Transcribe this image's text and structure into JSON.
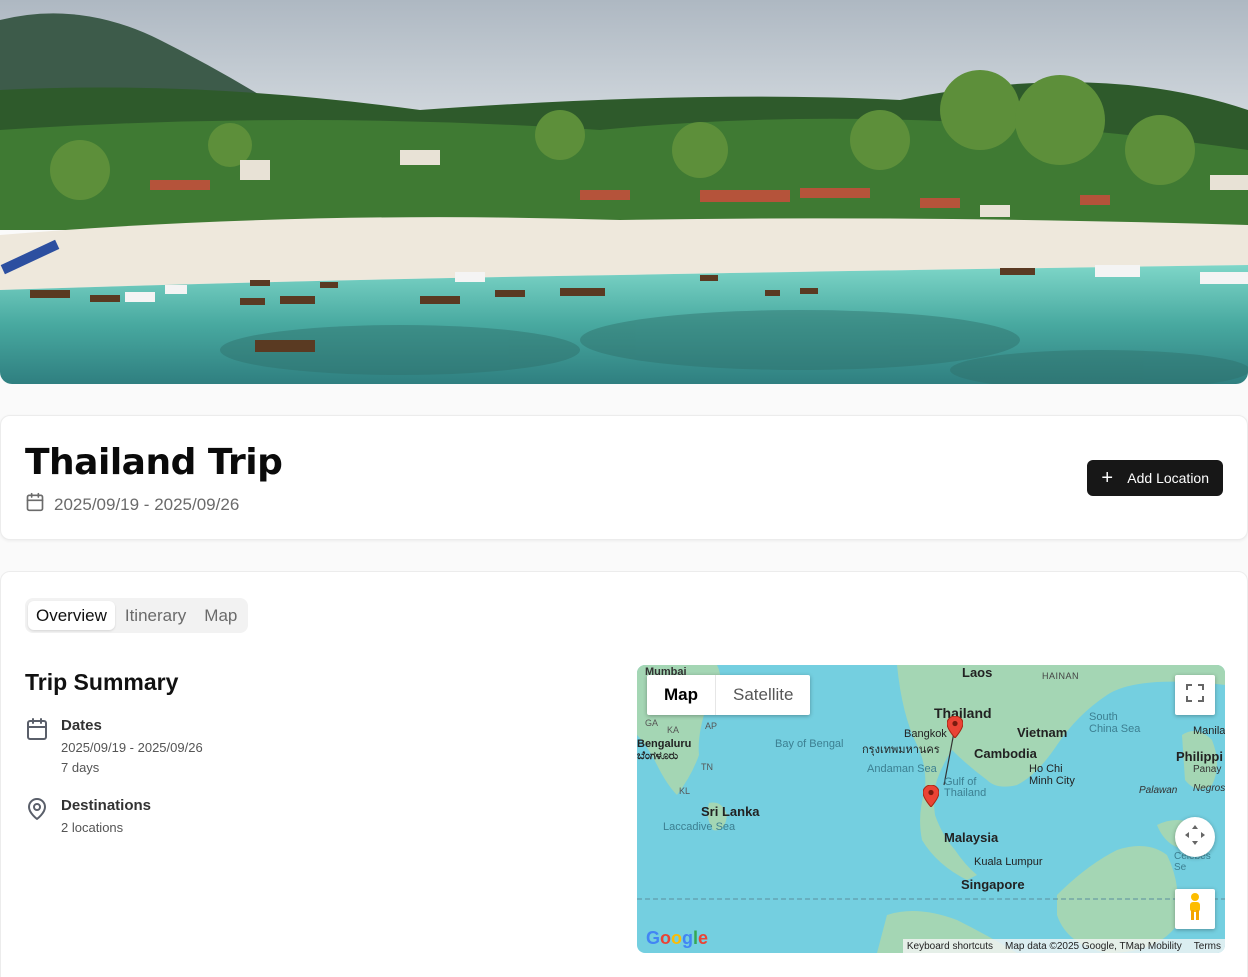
{
  "trip": {
    "title": "Thailand Trip",
    "date_range": "2025/09/19 - 2025/09/26",
    "add_location_label": "Add Location"
  },
  "tabs": [
    {
      "label": "Overview",
      "active": true
    },
    {
      "label": "Itinerary",
      "active": false
    },
    {
      "label": "Map",
      "active": false
    }
  ],
  "summary": {
    "title": "Trip Summary",
    "dates_label": "Dates",
    "dates_value": "2025/09/19 - 2025/09/26",
    "dates_duration": "7 days",
    "destinations_label": "Destinations",
    "destinations_value": "2 locations"
  },
  "map": {
    "type_map": "Map",
    "type_satellite": "Satellite",
    "labels": {
      "mumbai": "Mumbai",
      "laos": "Laos",
      "hainan": "HAINAN",
      "thailand": "Thailand",
      "bangkok": "Bangkok",
      "bangkok_thai": "กรุงเทพมหานคร",
      "vietnam": "Vietnam",
      "south_china_sea": "South China Sea",
      "manila": "Manila",
      "philippines": "Philippi",
      "panay": "Panay",
      "palawan": "Palawan",
      "negros": "Negros",
      "bengaluru": "Bengaluru",
      "bengaluru_local": "ಬೆಂಗಳೂರು",
      "bay_of_bengal": "Bay of Bengal",
      "cambodia": "Cambodia",
      "andaman_sea": "Andaman Sea",
      "ho_chi_minh": "Ho Chi Minh City",
      "gulf_of_thailand": "Gulf of Thailand",
      "sri_lanka": "Sri Lanka",
      "laccadive_sea": "Laccadive Sea",
      "malaysia": "Malaysia",
      "kuala_lumpur": "Kuala Lumpur",
      "singapore": "Singapore",
      "celebes_sea": "Celebes Se",
      "ga": "GA",
      "ka": "KA",
      "ap": "AP",
      "tn": "TN",
      "kl": "KL"
    },
    "attribution": {
      "shortcuts": "Keyboard shortcuts",
      "data": "Map data ©2025 Google, TMap Mobility",
      "terms": "Terms"
    },
    "google_logo": "Google"
  },
  "icons": {
    "calendar": "calendar-icon",
    "map_pin": "map-pin-icon",
    "plus": "plus-icon",
    "fullscreen": "fullscreen-icon",
    "camera_control": "camera-control-icon",
    "pegman": "pegman-icon"
  }
}
